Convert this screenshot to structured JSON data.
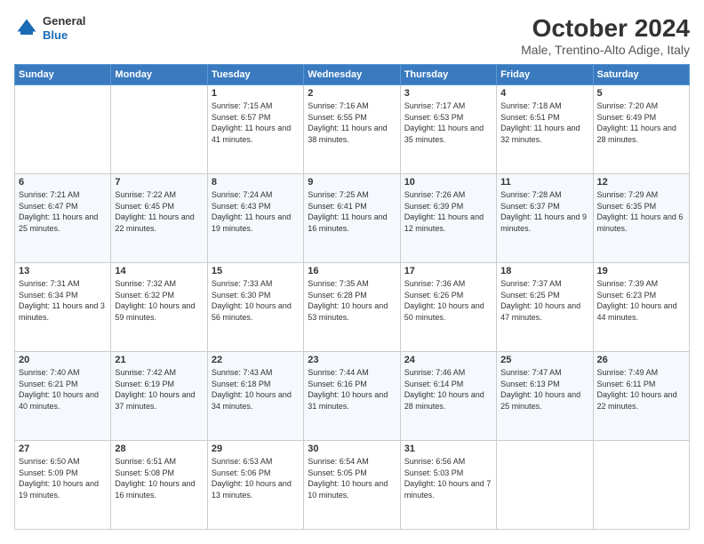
{
  "logo": {
    "general": "General",
    "blue": "Blue"
  },
  "title": "October 2024",
  "subtitle": "Male, Trentino-Alto Adige, Italy",
  "days_header": [
    "Sunday",
    "Monday",
    "Tuesday",
    "Wednesday",
    "Thursday",
    "Friday",
    "Saturday"
  ],
  "weeks": [
    [
      {
        "day": "",
        "info": ""
      },
      {
        "day": "",
        "info": ""
      },
      {
        "day": "1",
        "info": "Sunrise: 7:15 AM\nSunset: 6:57 PM\nDaylight: 11 hours and 41 minutes."
      },
      {
        "day": "2",
        "info": "Sunrise: 7:16 AM\nSunset: 6:55 PM\nDaylight: 11 hours and 38 minutes."
      },
      {
        "day": "3",
        "info": "Sunrise: 7:17 AM\nSunset: 6:53 PM\nDaylight: 11 hours and 35 minutes."
      },
      {
        "day": "4",
        "info": "Sunrise: 7:18 AM\nSunset: 6:51 PM\nDaylight: 11 hours and 32 minutes."
      },
      {
        "day": "5",
        "info": "Sunrise: 7:20 AM\nSunset: 6:49 PM\nDaylight: 11 hours and 28 minutes."
      }
    ],
    [
      {
        "day": "6",
        "info": "Sunrise: 7:21 AM\nSunset: 6:47 PM\nDaylight: 11 hours and 25 minutes."
      },
      {
        "day": "7",
        "info": "Sunrise: 7:22 AM\nSunset: 6:45 PM\nDaylight: 11 hours and 22 minutes."
      },
      {
        "day": "8",
        "info": "Sunrise: 7:24 AM\nSunset: 6:43 PM\nDaylight: 11 hours and 19 minutes."
      },
      {
        "day": "9",
        "info": "Sunrise: 7:25 AM\nSunset: 6:41 PM\nDaylight: 11 hours and 16 minutes."
      },
      {
        "day": "10",
        "info": "Sunrise: 7:26 AM\nSunset: 6:39 PM\nDaylight: 11 hours and 12 minutes."
      },
      {
        "day": "11",
        "info": "Sunrise: 7:28 AM\nSunset: 6:37 PM\nDaylight: 11 hours and 9 minutes."
      },
      {
        "day": "12",
        "info": "Sunrise: 7:29 AM\nSunset: 6:35 PM\nDaylight: 11 hours and 6 minutes."
      }
    ],
    [
      {
        "day": "13",
        "info": "Sunrise: 7:31 AM\nSunset: 6:34 PM\nDaylight: 11 hours and 3 minutes."
      },
      {
        "day": "14",
        "info": "Sunrise: 7:32 AM\nSunset: 6:32 PM\nDaylight: 10 hours and 59 minutes."
      },
      {
        "day": "15",
        "info": "Sunrise: 7:33 AM\nSunset: 6:30 PM\nDaylight: 10 hours and 56 minutes."
      },
      {
        "day": "16",
        "info": "Sunrise: 7:35 AM\nSunset: 6:28 PM\nDaylight: 10 hours and 53 minutes."
      },
      {
        "day": "17",
        "info": "Sunrise: 7:36 AM\nSunset: 6:26 PM\nDaylight: 10 hours and 50 minutes."
      },
      {
        "day": "18",
        "info": "Sunrise: 7:37 AM\nSunset: 6:25 PM\nDaylight: 10 hours and 47 minutes."
      },
      {
        "day": "19",
        "info": "Sunrise: 7:39 AM\nSunset: 6:23 PM\nDaylight: 10 hours and 44 minutes."
      }
    ],
    [
      {
        "day": "20",
        "info": "Sunrise: 7:40 AM\nSunset: 6:21 PM\nDaylight: 10 hours and 40 minutes."
      },
      {
        "day": "21",
        "info": "Sunrise: 7:42 AM\nSunset: 6:19 PM\nDaylight: 10 hours and 37 minutes."
      },
      {
        "day": "22",
        "info": "Sunrise: 7:43 AM\nSunset: 6:18 PM\nDaylight: 10 hours and 34 minutes."
      },
      {
        "day": "23",
        "info": "Sunrise: 7:44 AM\nSunset: 6:16 PM\nDaylight: 10 hours and 31 minutes."
      },
      {
        "day": "24",
        "info": "Sunrise: 7:46 AM\nSunset: 6:14 PM\nDaylight: 10 hours and 28 minutes."
      },
      {
        "day": "25",
        "info": "Sunrise: 7:47 AM\nSunset: 6:13 PM\nDaylight: 10 hours and 25 minutes."
      },
      {
        "day": "26",
        "info": "Sunrise: 7:49 AM\nSunset: 6:11 PM\nDaylight: 10 hours and 22 minutes."
      }
    ],
    [
      {
        "day": "27",
        "info": "Sunrise: 6:50 AM\nSunset: 5:09 PM\nDaylight: 10 hours and 19 minutes."
      },
      {
        "day": "28",
        "info": "Sunrise: 6:51 AM\nSunset: 5:08 PM\nDaylight: 10 hours and 16 minutes."
      },
      {
        "day": "29",
        "info": "Sunrise: 6:53 AM\nSunset: 5:06 PM\nDaylight: 10 hours and 13 minutes."
      },
      {
        "day": "30",
        "info": "Sunrise: 6:54 AM\nSunset: 5:05 PM\nDaylight: 10 hours and 10 minutes."
      },
      {
        "day": "31",
        "info": "Sunrise: 6:56 AM\nSunset: 5:03 PM\nDaylight: 10 hours and 7 minutes."
      },
      {
        "day": "",
        "info": ""
      },
      {
        "day": "",
        "info": ""
      }
    ]
  ]
}
